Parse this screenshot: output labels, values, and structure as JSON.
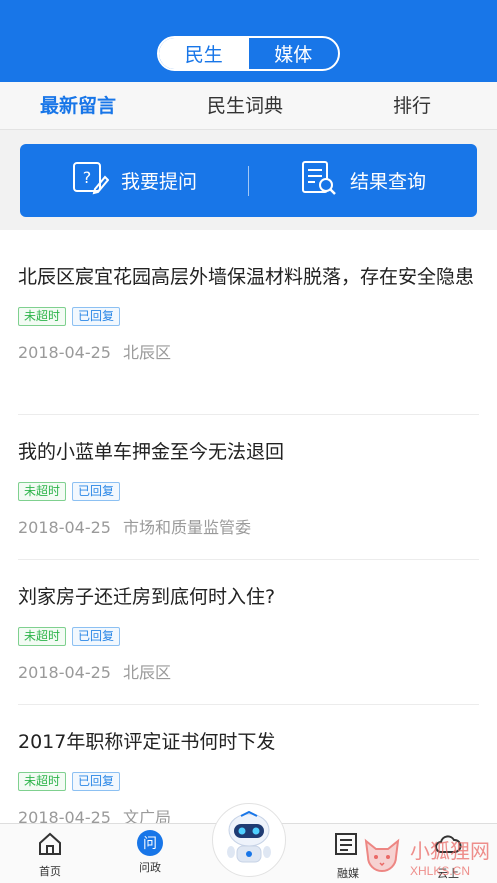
{
  "header": {
    "segment": {
      "active": "民生",
      "inactive": "媒体"
    }
  },
  "tabs": [
    {
      "label": "最新留言",
      "active": true
    },
    {
      "label": "民生词典",
      "active": false
    },
    {
      "label": "排行",
      "active": false
    }
  ],
  "actions": {
    "ask": "我要提问",
    "query": "结果查询"
  },
  "messages": [
    {
      "title": "北辰区宸宜花园高层外墙保温材料脱落，存在安全隐患",
      "badge1": "未超时",
      "badge2": "已回复",
      "date": "2018-04-25",
      "area": "北辰区"
    },
    {
      "title": "我的小蓝单车押金至今无法退回",
      "badge1": "未超时",
      "badge2": "已回复",
      "date": "2018-04-25",
      "area": "市场和质量监管委"
    },
    {
      "title": "刘家房子还迁房到底何时入住?",
      "badge1": "未超时",
      "badge2": "已回复",
      "date": "2018-04-25",
      "area": "北辰区"
    },
    {
      "title": "2017年职称评定证书何时下发",
      "badge1": "未超时",
      "badge2": "已回复",
      "date": "2018-04-25",
      "area": "文广局"
    }
  ],
  "bottom_nav": {
    "home": "首页",
    "ask": "问政",
    "ask_icon_text": "问",
    "media": "融媒",
    "cloud": "云上"
  },
  "watermark": {
    "main": "小狐狸网",
    "sub": "XHLKS.CN"
  },
  "colors": {
    "brand_blue": "#1876e8",
    "badge_green": "#2db44a",
    "badge_blue": "#2b87e6"
  }
}
